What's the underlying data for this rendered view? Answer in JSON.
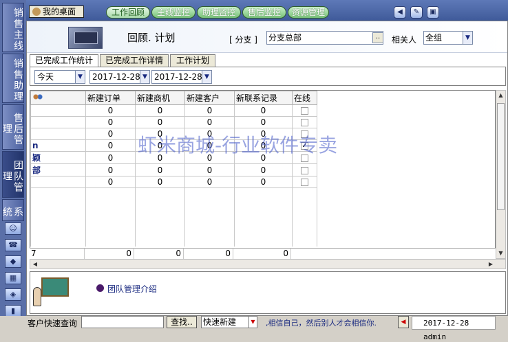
{
  "left_nav": {
    "tabs": [
      "销售主线",
      "销售助理",
      "售后管理",
      "团队管理",
      "系统"
    ]
  },
  "top_bar": {
    "desktop_label": "我的桌面",
    "tabs": [
      "工作回顾",
      "主线监控",
      "助理监控",
      "售后监控",
      "资源管理"
    ]
  },
  "header": {
    "title": "回顾. 计划",
    "branch_label": "[ 分支 ]",
    "branch_value": "分支总部",
    "branch_button": "..",
    "related_label": "相关人",
    "related_value": "全组"
  },
  "tabs": [
    "已完成工作统计",
    "已完成工作详情",
    "工作计划"
  ],
  "filters": {
    "period": "今天",
    "date_from": "2017-12-28",
    "date_to": "2017-12-28"
  },
  "grid": {
    "columns": [
      "新建订单",
      "新建商机",
      "新建客户",
      "新联系记录",
      "在线"
    ],
    "rows": [
      {
        "name": "",
        "values": [
          "0",
          "0",
          "0",
          "0"
        ],
        "online": false
      },
      {
        "name": "",
        "values": [
          "0",
          "0",
          "0",
          "0"
        ],
        "online": false
      },
      {
        "name": "",
        "values": [
          "0",
          "0",
          "0",
          "0"
        ],
        "online": false
      },
      {
        "name": "n",
        "values": [
          "0",
          "0",
          "0",
          "0"
        ],
        "online": true
      },
      {
        "name": "颖",
        "values": [
          "0",
          "0",
          "0",
          "0"
        ],
        "online": false
      },
      {
        "name": "部",
        "values": [
          "0",
          "0",
          "0",
          "0"
        ],
        "online": false
      },
      {
        "name": "",
        "values": [
          "0",
          "0",
          "0",
          "0"
        ],
        "online": false
      }
    ],
    "summary": [
      "7",
      "0",
      "0",
      "0",
      "0"
    ]
  },
  "intro": {
    "text": "团队管理介绍"
  },
  "bottom": {
    "quick_search_label": "客户快速查询",
    "search_button": "查找..",
    "quick_new": "快速新建",
    "motto": ",相信自己，然后别人才会相信你.",
    "status": "2017-12-28 admin"
  },
  "watermark": "虾米商城-行业软件专卖"
}
